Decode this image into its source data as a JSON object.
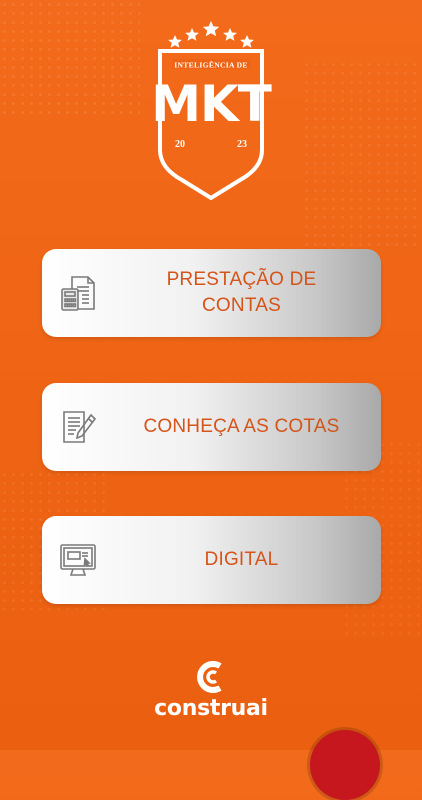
{
  "logo": {
    "top_text": "INTELIGÊNCIA DE",
    "main_text": "MKT",
    "year_left": "20",
    "year_right": "23"
  },
  "menu": [
    {
      "label": "PRESTAÇÃO DE\nCONTAS",
      "icon": "calculator-document-icon"
    },
    {
      "label": "CONHEÇA AS COTAS",
      "icon": "document-edit-icon"
    },
    {
      "label": "DIGITAL",
      "icon": "monitor-icon"
    }
  ],
  "brand": {
    "name": "construai"
  },
  "colors": {
    "background": "#ef6414",
    "button_text": "#d5541a",
    "white": "#ffffff",
    "corner_button": "#c6171f"
  }
}
